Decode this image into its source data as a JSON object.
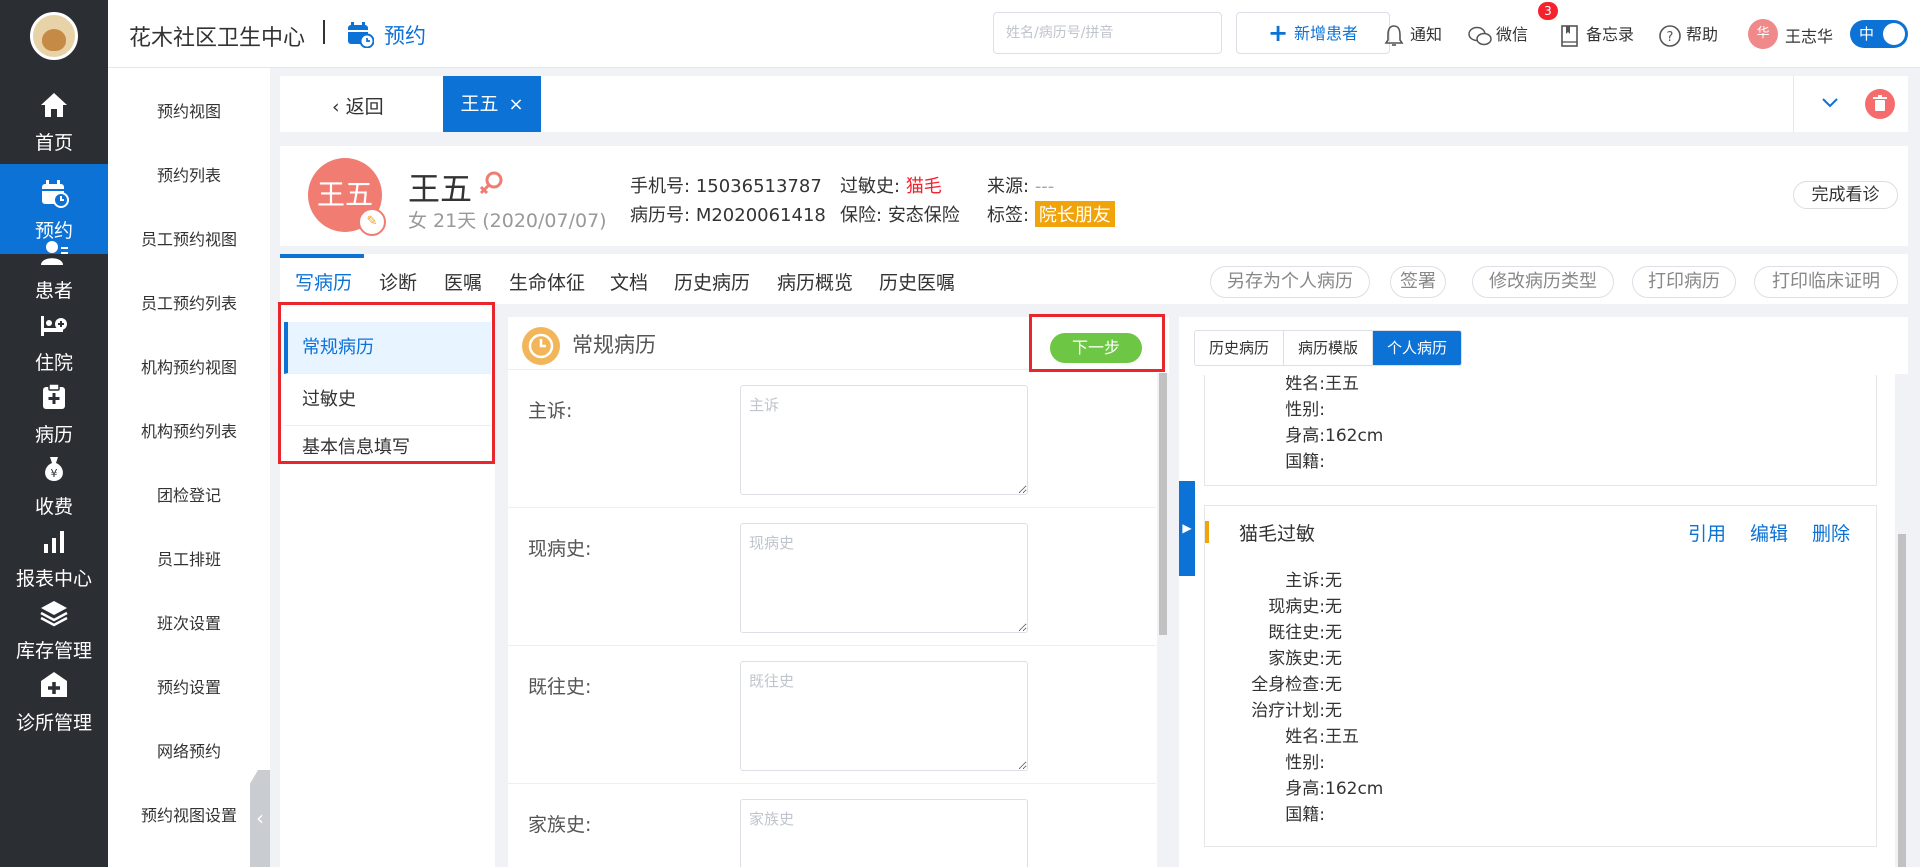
{
  "nav": {
    "items": [
      {
        "label": "首页",
        "icon": "home-icon"
      },
      {
        "label": "预约",
        "icon": "calendar-icon"
      },
      {
        "label": "患者",
        "icon": "patient-icon"
      },
      {
        "label": "住院",
        "icon": "bed-icon"
      },
      {
        "label": "病历",
        "icon": "medical-record-icon"
      },
      {
        "label": "收费",
        "icon": "money-bag-icon"
      },
      {
        "label": "报表中心",
        "icon": "bar-chart-icon"
      },
      {
        "label": "库存管理",
        "icon": "layers-icon"
      },
      {
        "label": "诊所管理",
        "icon": "clinic-icon"
      }
    ]
  },
  "subnav": {
    "items": [
      "预约视图",
      "预约列表",
      "员工预约视图",
      "员工预约列表",
      "机构预约视图",
      "机构预约列表",
      "团检登记",
      "员工排班",
      "班次设置",
      "预约设置",
      "网络预约",
      "预约视图设置"
    ]
  },
  "header": {
    "clinic": "花木社区卫生中心",
    "module": "预约",
    "search_placeholder": "姓名/病历号/拼音",
    "new_patient": "新增患者",
    "notify": "通知",
    "wechat": "微信",
    "wechat_badge": "3",
    "memo": "备忘录",
    "help": "帮助",
    "user_avatar": "华",
    "user": "王志华",
    "lang": "中"
  },
  "tabbar": {
    "back": "返回",
    "tab": "王五"
  },
  "patient": {
    "avatar": "王五",
    "name": "王五",
    "meta": "女  21天  (2020/07/07)",
    "phone_label": "手机号:",
    "phone": "15036513787",
    "allergy_label": "过敏史:",
    "allergy": "猫毛",
    "source_label": "来源:",
    "source": "---",
    "record_label": "病历号:",
    "record": "M2020061418",
    "insurance_label": "保险:",
    "insurance": "安态保险",
    "tag_label": "标签:",
    "tag": "院长朋友",
    "finish": "完成看诊"
  },
  "record_tabs": [
    "写病历",
    "诊断",
    "医嘱",
    "生命体征",
    "文档",
    "历史病历",
    "病历概览",
    "历史医嘱"
  ],
  "record_actions": [
    "另存为个人病历",
    "签署",
    "修改病历类型",
    "打印病历",
    "打印临床证明"
  ],
  "left_list": [
    "常规病历",
    "过敏史",
    "基本信息填写"
  ],
  "form": {
    "title": "常规病历",
    "next": "下一步",
    "fields": [
      {
        "label": "主诉:",
        "placeholder": "主诉"
      },
      {
        "label": "现病史:",
        "placeholder": "现病史"
      },
      {
        "label": "既往史:",
        "placeholder": "既往史"
      },
      {
        "label": "家族史:",
        "placeholder": "家族史"
      }
    ]
  },
  "right": {
    "tabs": [
      "历史病历",
      "病历模版",
      "个人病历"
    ],
    "card1": [
      {
        "k": "姓名:",
        "v": "王五"
      },
      {
        "k": "性别:",
        "v": ""
      },
      {
        "k": "身高:",
        "v": "162cm"
      },
      {
        "k": "国籍:",
        "v": ""
      }
    ],
    "card2": {
      "title": "猫毛过敏",
      "actions": [
        "引用",
        "编辑",
        "删除"
      ],
      "rows": [
        {
          "k": "主诉:",
          "v": "无"
        },
        {
          "k": "现病史:",
          "v": "无"
        },
        {
          "k": "既往史:",
          "v": "无"
        },
        {
          "k": "家族史:",
          "v": "无"
        },
        {
          "k": "全身检查:",
          "v": "无"
        },
        {
          "k": "治疗计划:",
          "v": "无"
        },
        {
          "k": "姓名:",
          "v": "王五"
        },
        {
          "k": "性别:",
          "v": ""
        },
        {
          "k": "身高:",
          "v": "162cm"
        },
        {
          "k": "国籍:",
          "v": ""
        }
      ]
    }
  }
}
